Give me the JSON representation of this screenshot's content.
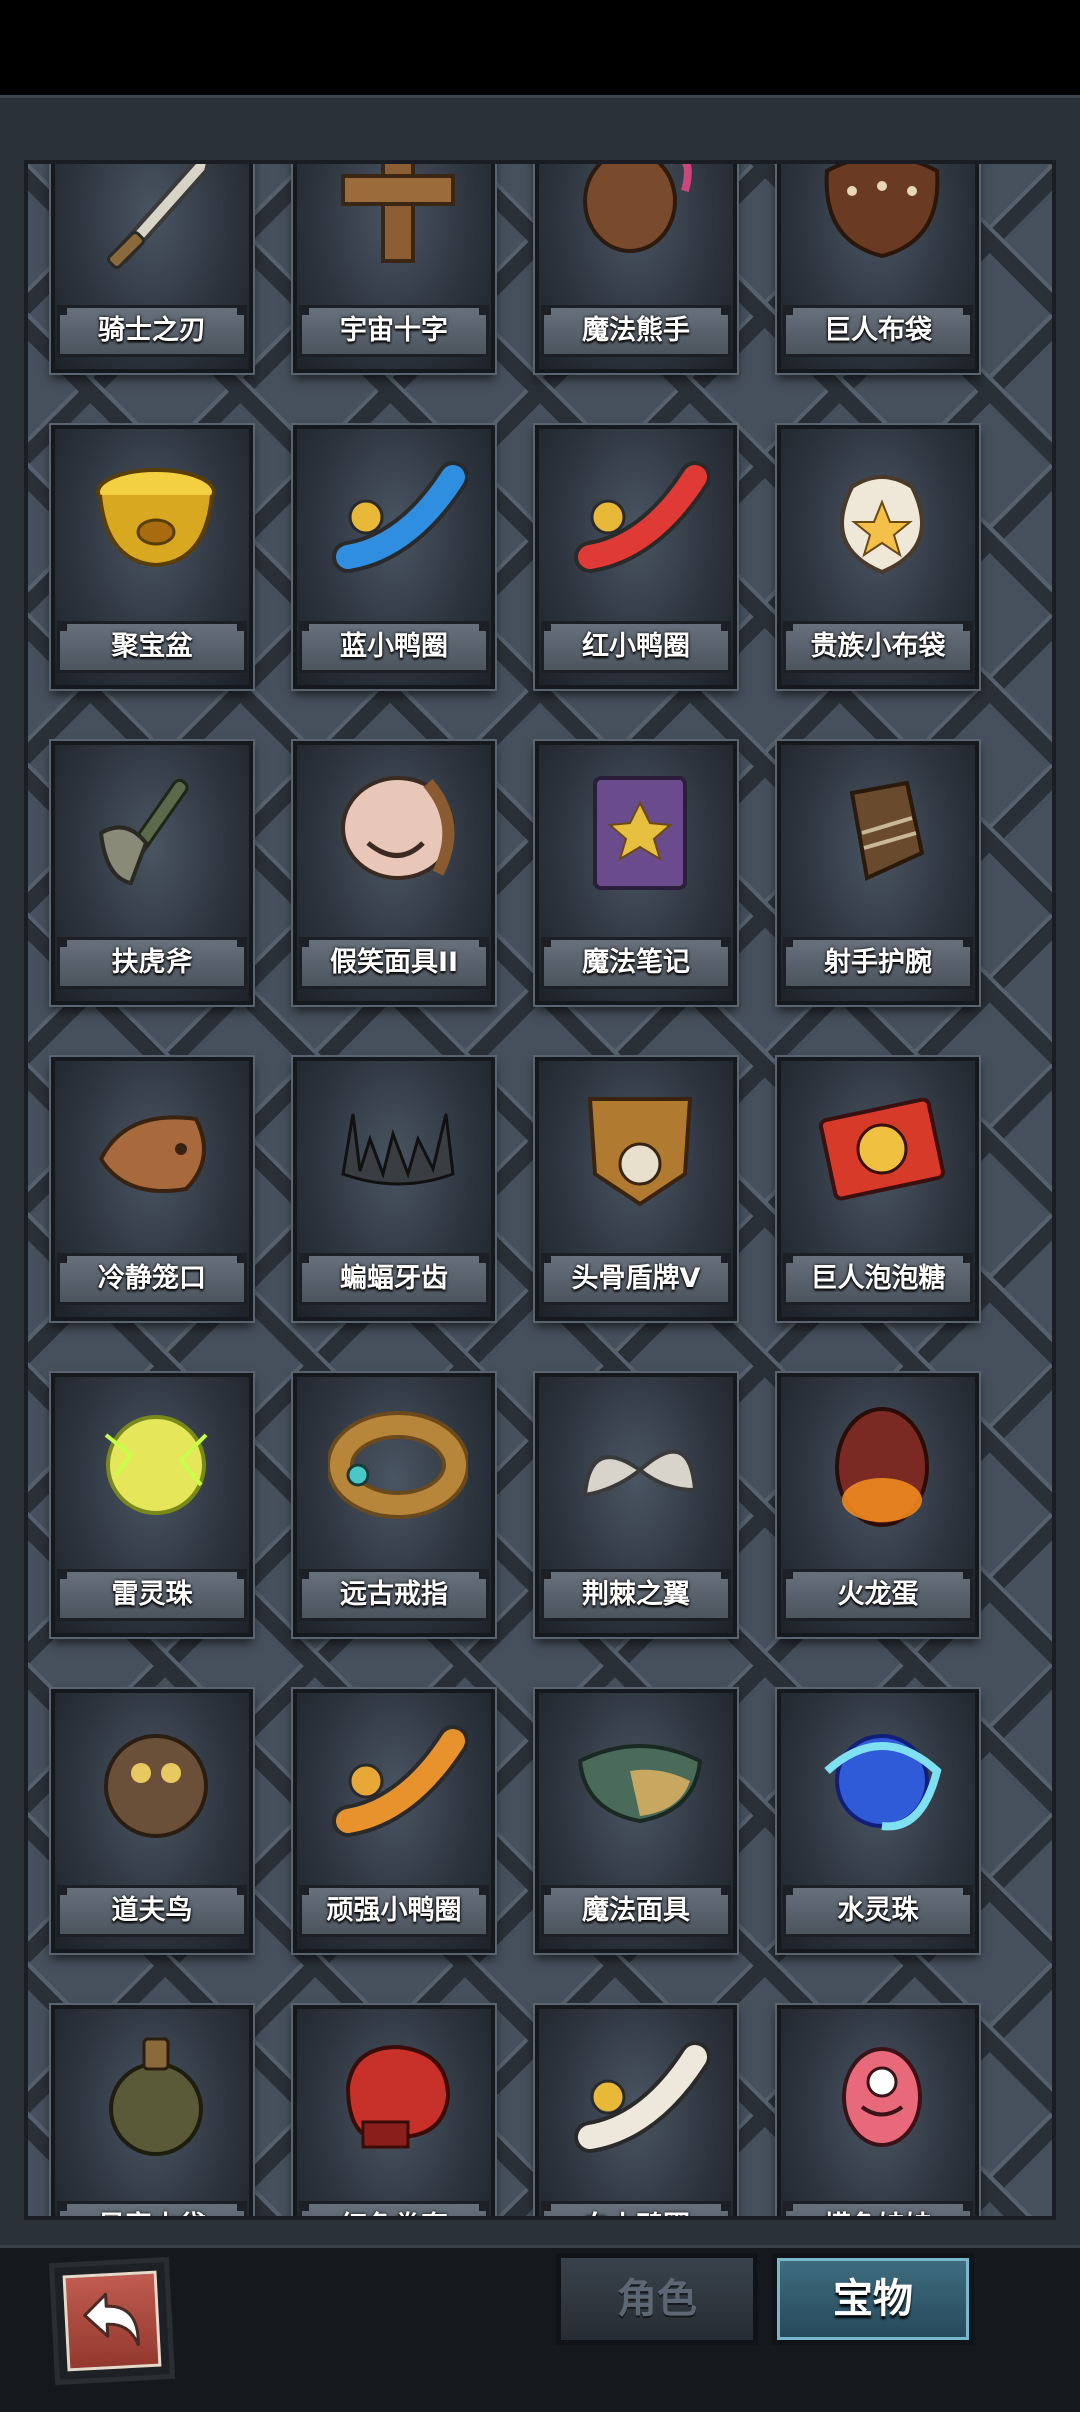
{
  "items": [
    {
      "name": "骑士之刃",
      "icon": "knight-blade-icon"
    },
    {
      "name": "宇宙十字",
      "icon": "cosmic-cross-icon"
    },
    {
      "name": "魔法熊手",
      "icon": "magic-bear-paw-icon"
    },
    {
      "name": "巨人布袋",
      "icon": "giant-sack-icon"
    },
    {
      "name": "聚宝盆",
      "icon": "treasure-bowl-icon"
    },
    {
      "name": "蓝小鸭圈",
      "icon": "blue-duck-ring-icon"
    },
    {
      "name": "红小鸭圈",
      "icon": "red-duck-ring-icon"
    },
    {
      "name": "贵族小布袋",
      "icon": "noble-pouch-icon"
    },
    {
      "name": "扶虎斧",
      "icon": "tiger-axe-icon"
    },
    {
      "name": "假笑面具II",
      "icon": "smile-mask-icon"
    },
    {
      "name": "魔法笔记",
      "icon": "magic-notebook-icon"
    },
    {
      "name": "射手护腕",
      "icon": "archer-bracer-icon"
    },
    {
      "name": "冷静笼口",
      "icon": "muzzle-icon"
    },
    {
      "name": "蝙蝠牙齿",
      "icon": "bat-teeth-icon"
    },
    {
      "name": "头骨盾牌V",
      "icon": "skull-shield-icon"
    },
    {
      "name": "巨人泡泡糖",
      "icon": "bubblegum-box-icon"
    },
    {
      "name": "雷灵珠",
      "icon": "thunder-orb-icon"
    },
    {
      "name": "远古戒指",
      "icon": "ancient-ring-icon"
    },
    {
      "name": "荆棘之翼",
      "icon": "thorn-wings-icon"
    },
    {
      "name": "火龙蛋",
      "icon": "fire-dragon-egg-icon"
    },
    {
      "name": "道夫鸟",
      "icon": "owl-bird-icon"
    },
    {
      "name": "顽强小鸭圈",
      "icon": "orange-duck-ring-icon"
    },
    {
      "name": "魔法面具",
      "icon": "magic-mask-icon"
    },
    {
      "name": "水灵珠",
      "icon": "water-orb-icon"
    },
    {
      "name": "暴富水袋",
      "icon": "water-flask-icon"
    },
    {
      "name": "红色拳套",
      "icon": "boxing-glove-icon"
    },
    {
      "name": "白小鸭圈",
      "icon": "white-duck-ring-icon"
    },
    {
      "name": "摸鱼娃娃",
      "icon": "pink-doll-icon"
    }
  ],
  "tabs": {
    "character": "角色",
    "treasure": "宝物",
    "active": "treasure"
  },
  "colors": {
    "tab_active": "#2f5b6e",
    "back_button": "#a9473c"
  }
}
